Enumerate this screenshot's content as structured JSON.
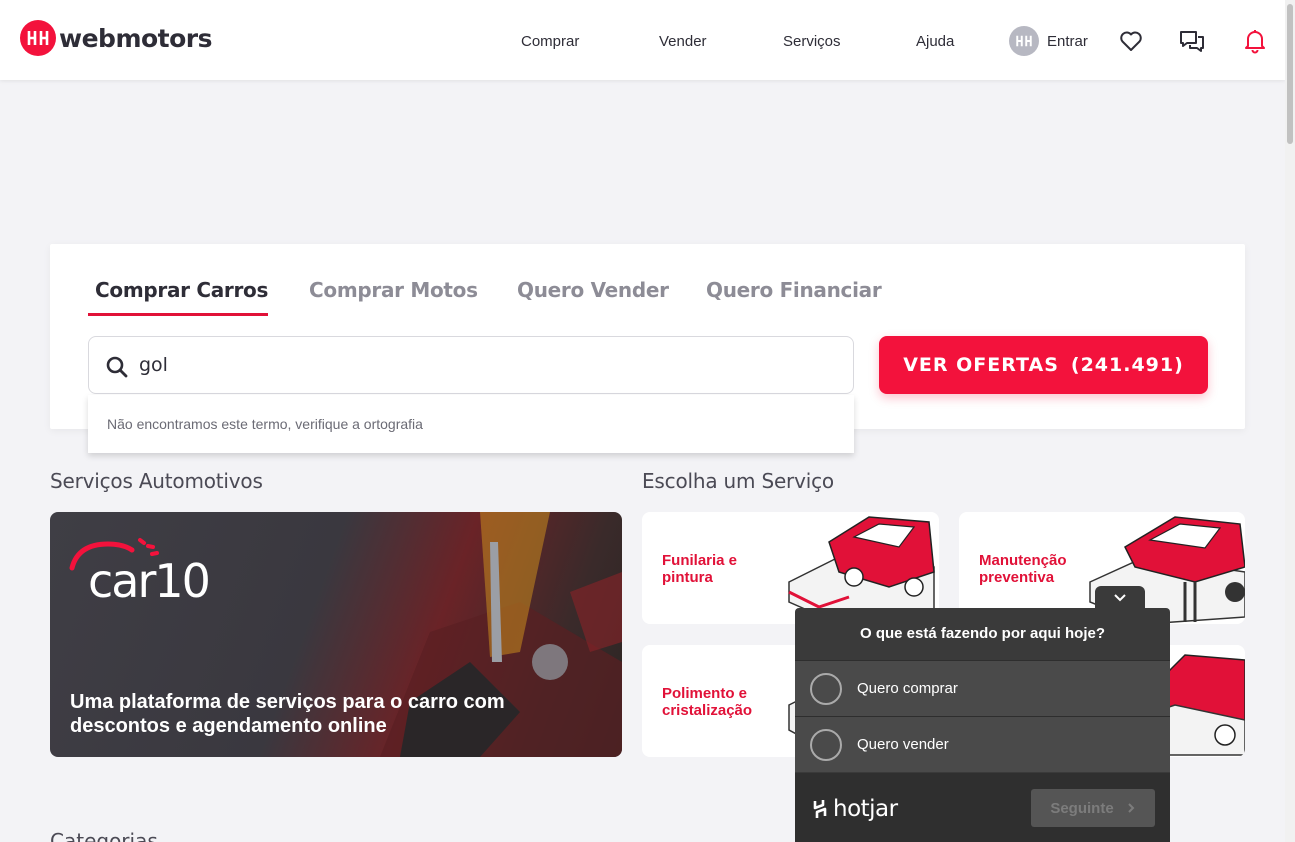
{
  "header": {
    "logo_text": "webmotors",
    "nav": [
      "Comprar",
      "Vender",
      "Serviços",
      "Ajuda"
    ],
    "login_label": "Entrar",
    "avatar_initials": "HH",
    "icons": [
      "heart-icon",
      "chat-icon",
      "bell-icon"
    ]
  },
  "search": {
    "tabs": [
      "Comprar Carros",
      "Comprar Motos",
      "Quero Vender",
      "Quero Financiar"
    ],
    "active_tab": "Comprar Carros",
    "input_value": "gol",
    "no_results": "Não encontramos este termo, verifique a ortografia",
    "offers_label": "VER OFERTAS",
    "offers_count": "(241.491)"
  },
  "services": {
    "title": "Serviços Automotivos",
    "banner_logo": "car10",
    "banner_text": "Uma plataforma de serviços para o carro com descontos e agendamento online"
  },
  "choose_service": {
    "title": "Escolha um Serviço",
    "items": [
      "Funilaria e pintura",
      "Manutenção preventiva",
      "Polimento e cristalização"
    ]
  },
  "categories_title": "Categorias",
  "hotjar": {
    "question": "O que está fazendo por aqui hoje?",
    "options": [
      "Quero comprar",
      "Quero vender"
    ],
    "brand": "hotjar",
    "next_label": "Seguinte"
  },
  "colors": {
    "brand_red": "#f3123c",
    "text_dark": "#2e2d37",
    "background": "#f3f3f6"
  }
}
